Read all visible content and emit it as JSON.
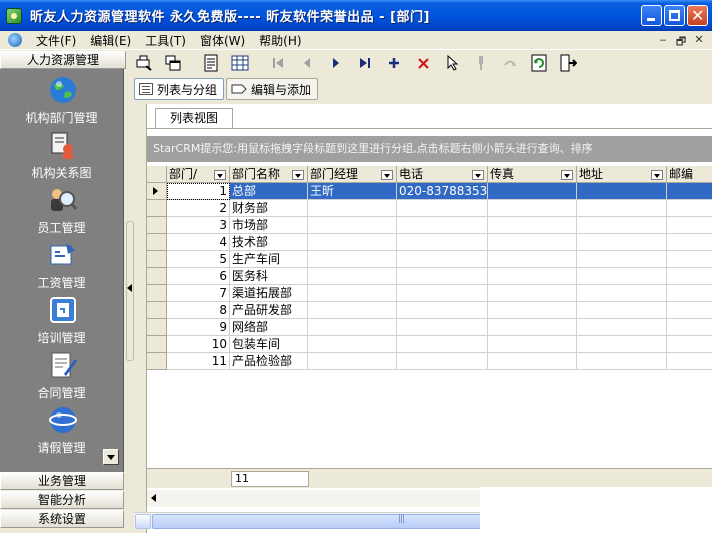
{
  "window": {
    "title": "昕友人力资源管理软件 永久免费版---- 昕友软件荣誉出品  - [部门]"
  },
  "menu": [
    "文件(F)",
    "编辑(E)",
    "工具(T)",
    "窗体(W)",
    "帮助(H)"
  ],
  "mdi_buttons": [
    "‒",
    "🗗",
    "✕"
  ],
  "nav": {
    "header": "人力资源管理",
    "items": [
      {
        "label": "机构部门管理",
        "icon": "globe-icon"
      },
      {
        "label": "机构关系图",
        "icon": "org-chart-icon"
      },
      {
        "label": "员工管理",
        "icon": "user-search-icon"
      },
      {
        "label": "工资管理",
        "icon": "salary-icon"
      },
      {
        "label": "培训管理",
        "icon": "training-icon"
      },
      {
        "label": "合同管理",
        "icon": "contract-icon"
      },
      {
        "label": "请假管理",
        "icon": "leave-icon"
      }
    ],
    "bottom": [
      "业务管理",
      "智能分析",
      "系统设置"
    ]
  },
  "toolbar": {
    "icons": [
      "print-preview-icon",
      "copy-window-icon",
      "report-icon",
      "grid-icon",
      "first-record-icon",
      "prev-record-icon",
      "next-record-icon",
      "last-record-icon",
      "add-icon",
      "delete-icon",
      "select-icon",
      "pin-icon",
      "undo-icon",
      "refresh-icon",
      "exit-icon"
    ]
  },
  "view_tabs": [
    "列表与分组",
    "编辑与添加"
  ],
  "list_tab": "列表视图",
  "hint": "StarCRM提示您:用鼠标拖拽字段标题到这里进行分组,点击标题右侧小箭头进行查询、排序",
  "grid": {
    "columns": [
      "部门/",
      "部门名称",
      "部门经理",
      "电话",
      "传真",
      "地址",
      "邮编"
    ],
    "rows": [
      {
        "id": "1",
        "name": "总部",
        "manager": "王昕",
        "phone": "020-83788353",
        "fax": "",
        "addr": "",
        "zip": ""
      },
      {
        "id": "2",
        "name": "财务部",
        "manager": "",
        "phone": "",
        "fax": "",
        "addr": "",
        "zip": ""
      },
      {
        "id": "3",
        "name": "市场部",
        "manager": "",
        "phone": "",
        "fax": "",
        "addr": "",
        "zip": ""
      },
      {
        "id": "4",
        "name": "技术部",
        "manager": "",
        "phone": "",
        "fax": "",
        "addr": "",
        "zip": ""
      },
      {
        "id": "5",
        "name": "生产车间",
        "manager": "",
        "phone": "",
        "fax": "",
        "addr": "",
        "zip": ""
      },
      {
        "id": "6",
        "name": "医务科",
        "manager": "",
        "phone": "",
        "fax": "",
        "addr": "",
        "zip": ""
      },
      {
        "id": "7",
        "name": "渠道拓展部",
        "manager": "",
        "phone": "",
        "fax": "",
        "addr": "",
        "zip": ""
      },
      {
        "id": "8",
        "name": "产品研发部",
        "manager": "",
        "phone": "",
        "fax": "",
        "addr": "",
        "zip": ""
      },
      {
        "id": "9",
        "name": "网络部",
        "manager": "",
        "phone": "",
        "fax": "",
        "addr": "",
        "zip": ""
      },
      {
        "id": "10",
        "name": "包装车间",
        "manager": "",
        "phone": "",
        "fax": "",
        "addr": "",
        "zip": ""
      },
      {
        "id": "11",
        "name": "产品检验部",
        "manager": "",
        "phone": "",
        "fax": "",
        "addr": "",
        "zip": ""
      }
    ],
    "record_count": "11"
  },
  "colors": {
    "title_bar": "#0154dd",
    "selection": "#316ac5",
    "nav_background": "#808080",
    "hint_background": "#a0a0a0"
  }
}
